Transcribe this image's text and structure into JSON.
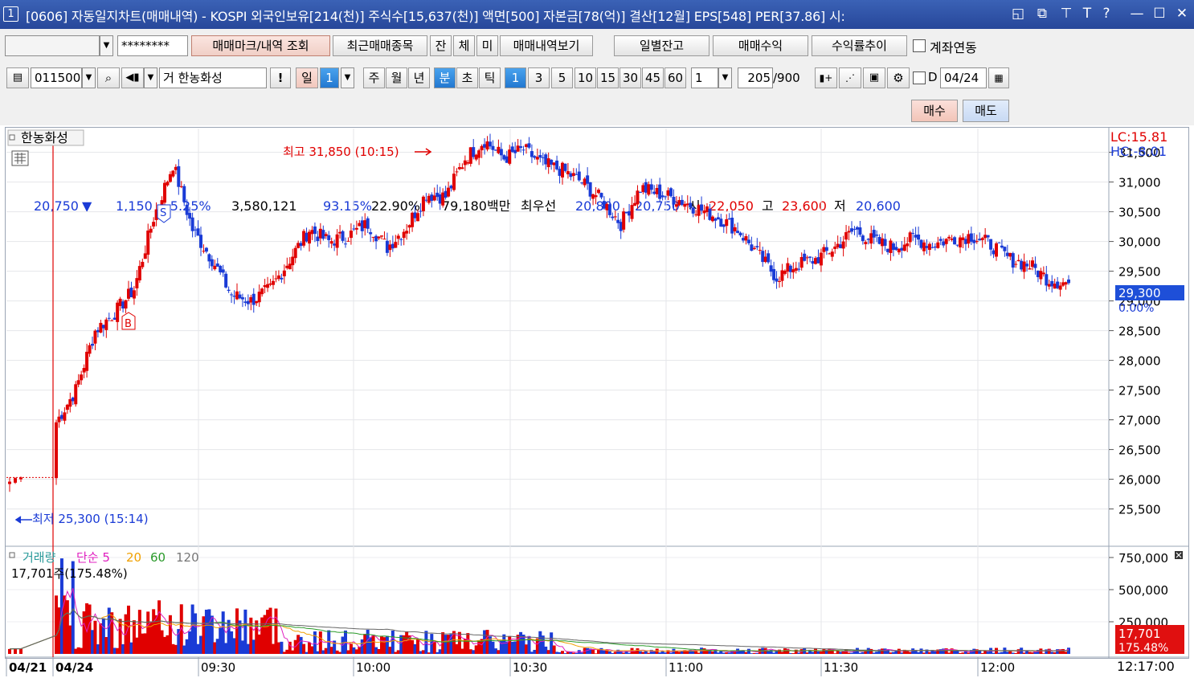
{
  "window": {
    "number": "1",
    "title": "[0606] 자동일지차트(매매내역) - KOSPI 외국인보유[214(천)] 주식수[15,637(천)] 액면[500] 자본금[78(억)] 결산[12월] EPS[548] PER[37.86] 시:",
    "controls": [
      "◱",
      "⧉",
      "✕̲",
      "T",
      "?",
      "—",
      "☐",
      "✕"
    ]
  },
  "toolbar1": {
    "account_value": "",
    "password_value": "********",
    "buttons": [
      "매매마크/내역 조회",
      "최근매매종목",
      "잔",
      "체",
      "미",
      "매매내역보기"
    ],
    "right_buttons": [
      "일별잔고",
      "매매수익",
      "수익률추이"
    ],
    "link_label": "계좌연동"
  },
  "toolbar2": {
    "stock_code": "011500",
    "stock_name": "한농화성",
    "exchange": "거",
    "period_day": "일",
    "period_value": "1",
    "periods": [
      "주",
      "월",
      "년",
      "분",
      "초",
      "틱"
    ],
    "minute_options": [
      "1",
      "3",
      "5",
      "10",
      "15",
      "30",
      "45",
      "60"
    ],
    "unit_value": "1",
    "count": "205",
    "count_total": "/900",
    "date_value": "04/24"
  },
  "quote": {
    "price": "20,750",
    "change": "1,150",
    "change_pct": "-5.25%",
    "volume": "3,580,121",
    "ratio1": "93.15%",
    "ratio2": "22.90%",
    "amount": "79,180백만",
    "best_label": "최우선",
    "best_ask": "20,800",
    "best_bid": "20,750",
    "open_label": "시",
    "open": "22,050",
    "high_label": "고",
    "high": "23,600",
    "low_label": "저",
    "low": "20,600",
    "buy_button": "매수",
    "sell_button": "매도"
  },
  "chart": {
    "stock_label": "한농화성",
    "max_annotation": "최고 31,850 (10:15)",
    "min_annotation": "최저 25,300 (15:14)",
    "lc_label": "LC:15.81",
    "hc_label": "HC:-8.01",
    "current_price": "29,300",
    "current_pct": "0.00%",
    "buy_marker": "B",
    "sell_marker": "S",
    "volume_title": "거래량",
    "ma_labels": [
      "단순 5",
      "20",
      "60",
      "120"
    ],
    "volume_info": "17,701주(175.48%)",
    "volume_current": "17,701",
    "volume_pct": "175.48%",
    "time_now": "12:17:00",
    "colors": {
      "up": "#e00000",
      "down": "#1a3bd6",
      "ma5": "#e020c0",
      "ma20": "#f0a000",
      "ma60": "#2a9a2a",
      "ma120": "#666666"
    }
  },
  "chart_data": {
    "type": "candlestick",
    "price_ticks": [
      "31,500",
      "31,000",
      "30,500",
      "30,000",
      "29,500",
      "29,000",
      "28,500",
      "28,000",
      "27,500",
      "27,000",
      "26,500",
      "26,000",
      "25,500"
    ],
    "price_tick_values": [
      31500,
      31000,
      30500,
      30000,
      29500,
      29000,
      28500,
      28000,
      27500,
      27000,
      26500,
      26000,
      25500
    ],
    "volume_ticks": [
      "750,000",
      "500,000",
      "250,000"
    ],
    "volume_tick_values": [
      750000,
      500000,
      250000
    ],
    "time_labels": [
      "04/21",
      "04/24",
      "09:30",
      "10:00",
      "10:30",
      "11:00",
      "11:30",
      "12:00"
    ],
    "price_range": [
      24900,
      31900
    ],
    "volume_max": 1000000,
    "anchors": [
      [
        25960,
        26020,
        26030
      ],
      [
        26960,
        27500,
        28500,
        28800,
        29200,
        30400,
        31300
      ],
      [
        30200,
        29700,
        29100,
        29000,
        29200,
        29700,
        30200,
        30000
      ],
      [
        30100,
        30300,
        29900,
        30250,
        30800,
        30750,
        31400,
        31700
      ],
      [
        31400,
        31550,
        31300,
        31200,
        31000,
        30700,
        30300,
        30900
      ],
      [
        30800,
        30700,
        30550,
        30400,
        30200,
        29800,
        29400,
        29600
      ],
      [
        29700,
        29900,
        30200,
        30000,
        29900,
        30050,
        29950,
        30050
      ],
      [
        30100,
        29950,
        29700,
        29600,
        29350,
        29300
      ]
    ]
  }
}
